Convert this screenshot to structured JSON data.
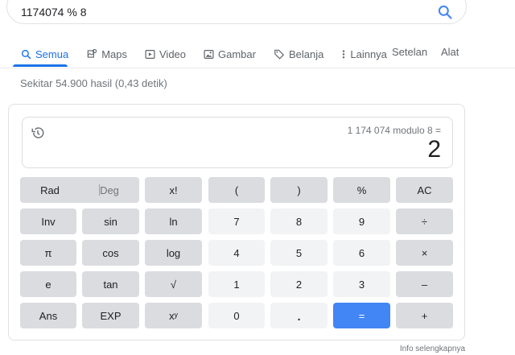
{
  "search": {
    "query": "1174074 % 8"
  },
  "tabs": [
    {
      "label": "Semua",
      "icon": "search-icon"
    },
    {
      "label": "Maps",
      "icon": "map-icon"
    },
    {
      "label": "Video",
      "icon": "video-icon"
    },
    {
      "label": "Gambar",
      "icon": "image-icon"
    },
    {
      "label": "Belanja",
      "icon": "tag-icon"
    },
    {
      "label": "Lainnya",
      "icon": "more-vert-icon"
    }
  ],
  "tools": {
    "settings": "Setelan",
    "tools": "Alat"
  },
  "stats": "Sekitar 54.900 hasil (0,43 detik)",
  "calculator": {
    "expression": "1 174 074 modulo 8 =",
    "result": "2",
    "keys": {
      "rad": "Rad",
      "deg": "Deg",
      "fact": "x!",
      "lparen": "(",
      "rparen": ")",
      "percent": "%",
      "ac": "AC",
      "inv": "Inv",
      "sin": "sin",
      "ln": "ln",
      "k7": "7",
      "k8": "8",
      "k9": "9",
      "div": "÷",
      "pi": "π",
      "cos": "cos",
      "log": "log",
      "k4": "4",
      "k5": "5",
      "k6": "6",
      "mul": "×",
      "e": "e",
      "tan": "tan",
      "sqrt": "√",
      "k1": "1",
      "k2": "2",
      "k3": "3",
      "minus": "–",
      "ans": "Ans",
      "exp": "EXP",
      "pow": "xʸ",
      "k0": "0",
      "dot": ".",
      "eq": "=",
      "plus": "+"
    }
  },
  "footer": "Info selengkapnya",
  "colors": {
    "accent": "#1a73e8",
    "equals": "#4285f4"
  }
}
